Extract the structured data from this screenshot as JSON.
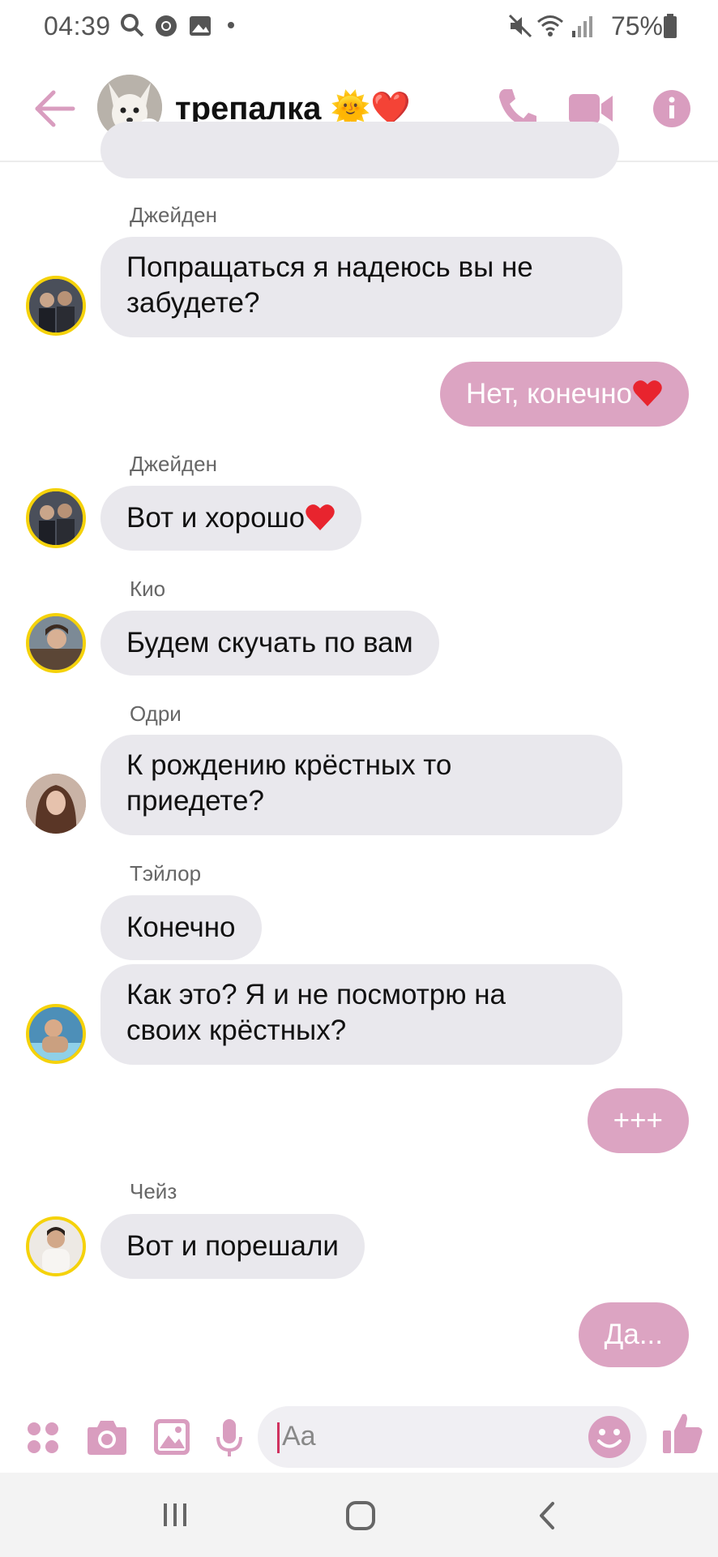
{
  "status_bar": {
    "time": "04:39",
    "battery": "75%"
  },
  "header": {
    "title": "трепалка 🌞❤️"
  },
  "messages": [
    {
      "sender": "Джейден",
      "text_lines": [
        "Попращаться я надеюсь вы не",
        "забудете?"
      ]
    },
    {
      "sender": "me",
      "text": "Нет, конечно"
    },
    {
      "sender": "Джейден",
      "text": "Вот и хорошо"
    },
    {
      "sender": "Кио",
      "text": "Будем скучать по вам"
    },
    {
      "sender": "Одри",
      "text_lines": [
        "К рождению крёстных то",
        "приедете?"
      ]
    },
    {
      "sender": "Тэйлор",
      "text": "Конечно"
    },
    {
      "sender": "Тэйлор",
      "text_lines": [
        "Как это? Я и не посмотрю на",
        "своих крёстных?"
      ]
    },
    {
      "sender": "me",
      "text": "+++"
    },
    {
      "sender": "Чейз",
      "text": "Вот и порешали"
    },
    {
      "sender": "me",
      "text": "Да..."
    }
  ],
  "composer": {
    "placeholder": "Aa"
  },
  "colors": {
    "accent": "#dca4c2",
    "incoming_bubble": "#e9e8ed",
    "online": "#31c24d",
    "story_ring": "#f5d20a"
  },
  "icons": [
    "search-icon",
    "chrome-icon",
    "gallery-icon",
    "mute-icon",
    "wifi-icon",
    "signal-icon",
    "battery-icon",
    "back-arrow-icon",
    "phone-icon",
    "video-icon",
    "info-icon",
    "apps-icon",
    "camera-icon",
    "image-icon",
    "mic-icon",
    "emoji-icon",
    "thumbs-up-icon",
    "recents-icon",
    "home-icon",
    "nav-back-icon"
  ]
}
